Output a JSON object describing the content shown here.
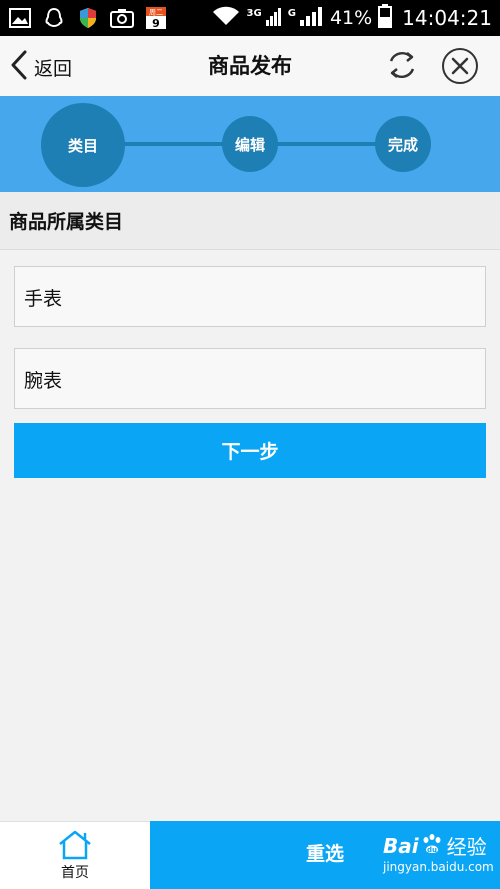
{
  "status_bar": {
    "network": "3G",
    "network2": "G",
    "battery": "41%",
    "time": "14:04:21",
    "calendar_day": "9",
    "calendar_label": "周二"
  },
  "header": {
    "back_label": "返回",
    "title": "商品发布"
  },
  "steps": [
    {
      "label": "类目"
    },
    {
      "label": "编辑"
    },
    {
      "label": "完成"
    }
  ],
  "section_label": "商品所属类目",
  "categories": [
    {
      "label": "手表"
    },
    {
      "label": "腕表"
    }
  ],
  "next_button": "下一步",
  "bottom_bar": {
    "home_label": "首页",
    "reset_label": "重选"
  },
  "watermark": {
    "brand_left": "Bai",
    "brand_right": "经验",
    "url": "jingyan.baidu.com"
  },
  "colors": {
    "steps_bg": "#47a7ec",
    "step_circle": "#1e7fb4",
    "primary": "#0aa6f5"
  }
}
